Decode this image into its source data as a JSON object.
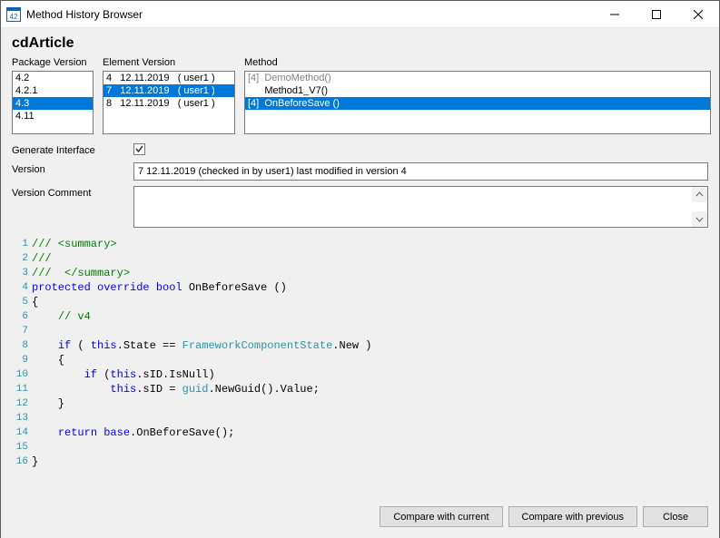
{
  "window": {
    "title": "Method History Browser"
  },
  "heading": "cdArticle",
  "labels": {
    "packageVersion": "Package Version",
    "elementVersion": "Element Version",
    "method": "Method",
    "generateInterface": "Generate Interface",
    "version": "Version",
    "versionComment": "Version Comment"
  },
  "packageVersions": [
    {
      "label": "4.2",
      "selected": false
    },
    {
      "label": "4.2.1",
      "selected": false
    },
    {
      "label": "4.3",
      "selected": true
    },
    {
      "label": "4.11",
      "selected": false
    }
  ],
  "elementVersions": [
    {
      "num": "4",
      "date": "12.11.2019",
      "user": "( user1 )",
      "selected": false
    },
    {
      "num": "7",
      "date": "12.11.2019",
      "user": "( user1 )",
      "selected": true
    },
    {
      "num": "8",
      "date": "12.11.2019",
      "user": "( user1 )",
      "selected": false
    }
  ],
  "methods": [
    {
      "v": "[4]",
      "name": "DemoMethod()",
      "gray": true,
      "selected": false,
      "indent": false
    },
    {
      "v": "",
      "name": "Method1_V7()",
      "gray": false,
      "selected": false,
      "indent": true
    },
    {
      "v": "[4]",
      "name": "OnBeforeSave ()",
      "gray": false,
      "selected": true,
      "indent": false
    }
  ],
  "generateInterface": true,
  "versionText": "7   12.11.2019 (checked in by user1)   last modified in version 4",
  "versionComment": "",
  "code": [
    {
      "n": "1",
      "spans": [
        {
          "t": "/// <summary>",
          "c": "comment"
        }
      ]
    },
    {
      "n": "2",
      "spans": [
        {
          "t": "///",
          "c": "comment"
        }
      ]
    },
    {
      "n": "3",
      "spans": [
        {
          "t": "///  </summary>",
          "c": "comment"
        }
      ]
    },
    {
      "n": "4",
      "spans": [
        {
          "t": "protected",
          "c": "keyword"
        },
        {
          "t": " ",
          "c": "normal"
        },
        {
          "t": "override",
          "c": "keyword"
        },
        {
          "t": " ",
          "c": "normal"
        },
        {
          "t": "bool",
          "c": "keyword"
        },
        {
          "t": " OnBeforeSave ()",
          "c": "normal"
        }
      ]
    },
    {
      "n": "5",
      "spans": [
        {
          "t": "{",
          "c": "normal"
        }
      ]
    },
    {
      "n": "6",
      "spans": [
        {
          "t": "    ",
          "c": "normal"
        },
        {
          "t": "// v4",
          "c": "comment"
        }
      ]
    },
    {
      "n": "7",
      "spans": [
        {
          "t": "",
          "c": "normal"
        }
      ]
    },
    {
      "n": "8",
      "spans": [
        {
          "t": "    ",
          "c": "normal"
        },
        {
          "t": "if",
          "c": "keyword"
        },
        {
          "t": " ( ",
          "c": "normal"
        },
        {
          "t": "this",
          "c": "keyword"
        },
        {
          "t": ".State == ",
          "c": "normal"
        },
        {
          "t": "FrameworkComponentState",
          "c": "type"
        },
        {
          "t": ".New )",
          "c": "normal"
        }
      ]
    },
    {
      "n": "9",
      "spans": [
        {
          "t": "    {",
          "c": "normal"
        }
      ]
    },
    {
      "n": "10",
      "spans": [
        {
          "t": "        ",
          "c": "normal"
        },
        {
          "t": "if",
          "c": "keyword"
        },
        {
          "t": " (",
          "c": "normal"
        },
        {
          "t": "this",
          "c": "keyword"
        },
        {
          "t": ".sID.IsNull)",
          "c": "normal"
        }
      ]
    },
    {
      "n": "11",
      "spans": [
        {
          "t": "            ",
          "c": "normal"
        },
        {
          "t": "this",
          "c": "keyword"
        },
        {
          "t": ".sID = ",
          "c": "normal"
        },
        {
          "t": "guid",
          "c": "type"
        },
        {
          "t": ".NewGuid().Value;",
          "c": "normal"
        }
      ]
    },
    {
      "n": "12",
      "spans": [
        {
          "t": "    }",
          "c": "normal"
        }
      ]
    },
    {
      "n": "13",
      "spans": [
        {
          "t": "",
          "c": "normal"
        }
      ]
    },
    {
      "n": "14",
      "spans": [
        {
          "t": "    ",
          "c": "normal"
        },
        {
          "t": "return",
          "c": "keyword"
        },
        {
          "t": " ",
          "c": "normal"
        },
        {
          "t": "base",
          "c": "keyword"
        },
        {
          "t": ".OnBeforeSave();",
          "c": "normal"
        }
      ]
    },
    {
      "n": "15",
      "spans": [
        {
          "t": "",
          "c": "normal"
        }
      ]
    },
    {
      "n": "16",
      "spans": [
        {
          "t": "}",
          "c": "normal"
        }
      ]
    }
  ],
  "buttons": {
    "compareCurrent": "Compare with current",
    "comparePrevious": "Compare with previous",
    "close": "Close"
  }
}
